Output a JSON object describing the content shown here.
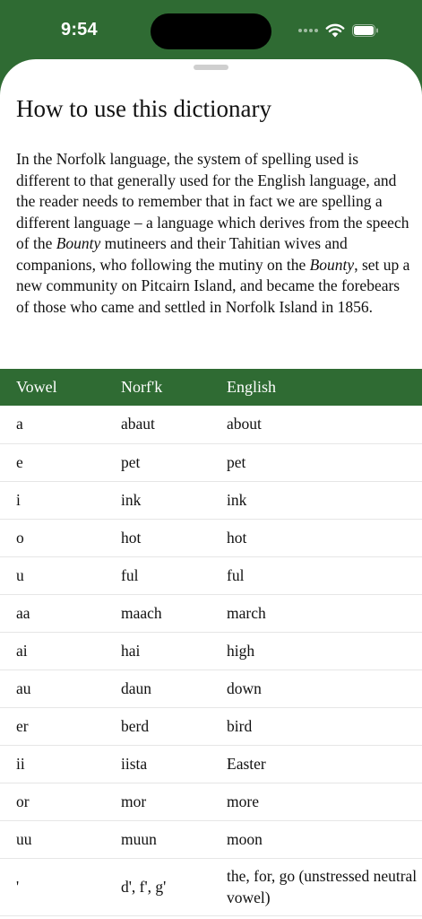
{
  "status_bar": {
    "time": "9:54"
  },
  "page": {
    "title": "How to use this dictionary",
    "intro": {
      "p1": "In the Norfolk language, the system of spelling used is different to that generally used for the English language, and the reader needs to remember that in fact we are spelling a different language – a language which derives from the speech of the ",
      "em1": "Bounty",
      "p2": " mutineers and their Tahitian wives and companions, who following the mutiny on the ",
      "em2": "Bounty",
      "p3": ", set up a new community on Pitcairn Island, and became the forebears of those who came and settled in Norfolk Island in 1856."
    }
  },
  "table": {
    "headers": [
      "Vowel",
      "Norf'k",
      "English"
    ],
    "rows": [
      [
        "a",
        "abaut",
        "about"
      ],
      [
        "e",
        "pet",
        "pet"
      ],
      [
        "i",
        "ink",
        "ink"
      ],
      [
        "o",
        "hot",
        "hot"
      ],
      [
        "u",
        "ful",
        "ful"
      ],
      [
        "aa",
        "maach",
        "march"
      ],
      [
        "ai",
        "hai",
        "high"
      ],
      [
        "au",
        "daun",
        "down"
      ],
      [
        "er",
        "berd",
        "bird"
      ],
      [
        "ii",
        "iista",
        "Easter"
      ],
      [
        "or",
        "mor",
        "more"
      ],
      [
        "uu",
        "muun",
        "moon"
      ],
      [
        "'",
        "d', f', g'",
        "the, for, go (unstressed neutral vowel)"
      ]
    ]
  },
  "colors": {
    "brand_green": "#2f6b33",
    "header_text": "#ffffff",
    "body_text": "#111111"
  },
  "icons": [
    "signal-icon",
    "wifi-icon",
    "battery-icon"
  ]
}
